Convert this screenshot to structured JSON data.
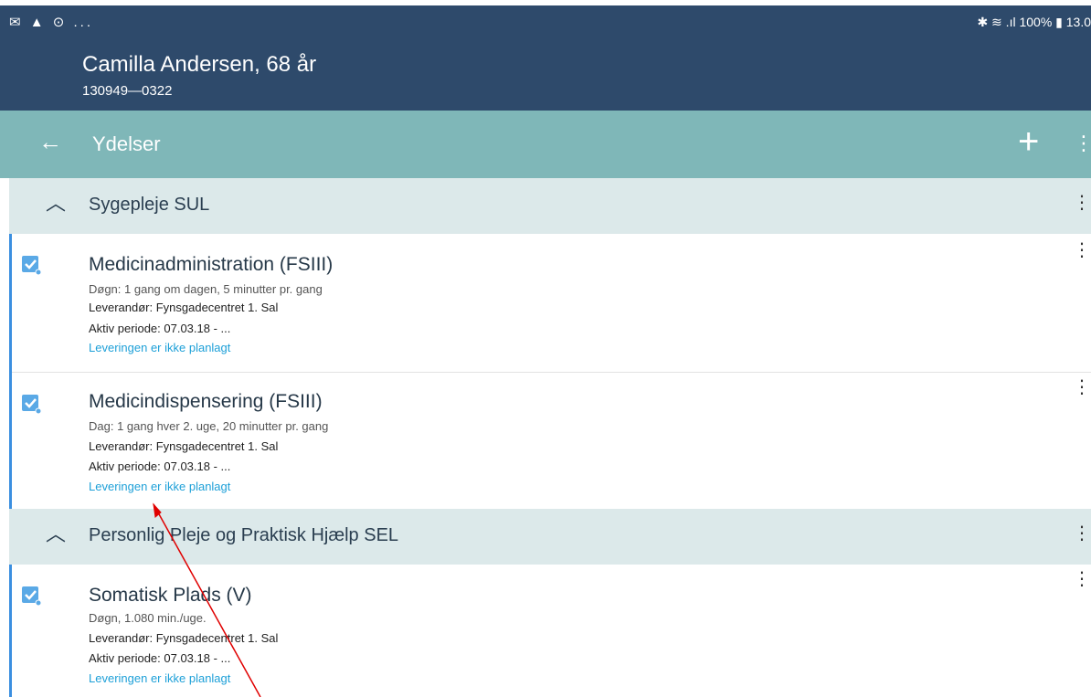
{
  "statusbar": {
    "left_icons": "✉ ▲ ⊙ ...",
    "right_text": "✱ ≋ .ıl 100% ▮ 13.0"
  },
  "patient": {
    "name": "Camilla Andersen, 68 år",
    "cpr": "130949—0322"
  },
  "appbar": {
    "back_icon": "←",
    "title": "Ydelser",
    "add_icon": "+",
    "menu_icon": "⋮"
  },
  "sections": [
    {
      "label": "Sygepleje SUL",
      "items": [
        {
          "title": "Medicinadministration (FSIII)",
          "frequency": "Døgn: 1 gang om dagen, 5 minutter pr. gang",
          "provider": "Leverandør: Fynsgadecentret 1. Sal",
          "period": "Aktiv periode: 07.03.18 - ...",
          "status": "Leveringen er ikke planlagt"
        },
        {
          "title": "Medicindispensering (FSIII)",
          "frequency": "Dag: 1 gang hver 2. uge, 20 minutter pr. gang",
          "provider": "Leverandør: Fynsgadecentret 1. Sal",
          "period": "Aktiv periode: 07.03.18 - ...",
          "status": "Leveringen er ikke planlagt"
        }
      ]
    },
    {
      "label": "Personlig Pleje og Praktisk Hjælp SEL",
      "items": [
        {
          "title": "Somatisk Plads (V)",
          "frequency": "Døgn, 1.080 min./uge.",
          "provider": "Leverandør: Fynsgadecentret 1. Sal",
          "period": "Aktiv periode: 07.03.18 - ...",
          "status": "Leveringen er ikke planlagt"
        }
      ]
    }
  ],
  "colors": {
    "header": "#2e4a6b",
    "appbar": "#7fb7b8",
    "section_bg": "#dce9ea",
    "link": "#1ea0d8",
    "accent_bar": "#3b8fe0",
    "annotation_arrow": "#e00000"
  },
  "icons": {
    "chevron": "chevron-up-icon",
    "check": "checked-task-icon",
    "more": "more-vert-icon"
  }
}
